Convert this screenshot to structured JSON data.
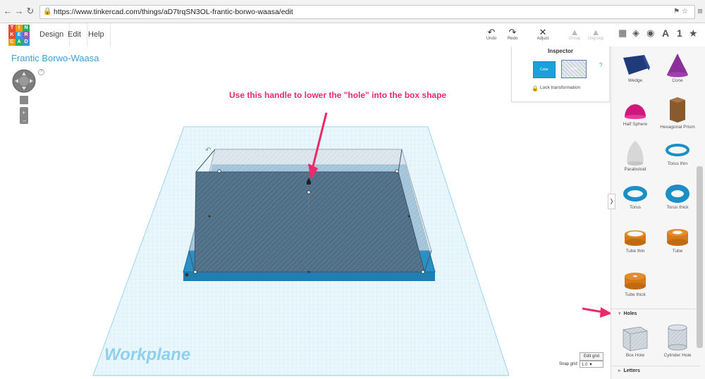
{
  "browser": {
    "url": "https://www.tinkercad.com/things/aD7trqSN3OL-frantic-borwo-waasa/edit",
    "back_icon": "back-arrow-icon",
    "forward_icon": "forward-arrow-icon",
    "reload_icon": "reload-icon"
  },
  "app": {
    "logo_letters": [
      "T",
      "I",
      "N",
      "K",
      "E",
      "R",
      "C",
      "A",
      "D"
    ],
    "logo_colors": [
      "#e94b35",
      "#f39c12",
      "#27ae60",
      "#e94b35",
      "#3498db",
      "#9b59b6",
      "#f39c12",
      "#27ae60",
      "#3498db"
    ],
    "menu": [
      "Design",
      "Edit",
      "Help"
    ],
    "toolbar": [
      {
        "label": "Undo",
        "icon": "↶",
        "disabled": false
      },
      {
        "label": "Redo",
        "icon": "↷",
        "disabled": false
      },
      {
        "label": "Adjust",
        "icon": "✕",
        "disabled": false
      },
      {
        "label": "Group",
        "icon": "▲",
        "disabled": true
      },
      {
        "label": "Ungroup",
        "icon": "▲",
        "disabled": true
      }
    ],
    "panel_tabs": [
      "▦",
      "◈",
      "◉",
      "A",
      "1",
      "★"
    ]
  },
  "canvas": {
    "title": "Frantic Borwo-Waasa",
    "workplane_label": "Workplane",
    "annotation": "Use this handle to lower the \"hole\" into the box shape",
    "edit_grid": "Edit grid",
    "snap_label": "Snap grid",
    "snap_value": "1.0 ▼",
    "help": "?"
  },
  "inspector": {
    "title": "Inspector",
    "color_label": "Color",
    "hole_label": "Hole",
    "help": "?",
    "lock_label": "Lock transformation"
  },
  "shapes": [
    {
      "label": "Wedge",
      "icon": "wedge-icon"
    },
    {
      "label": "Cone",
      "icon": "cone-icon"
    },
    {
      "label": "Half Sphere",
      "icon": "half-sphere-icon"
    },
    {
      "label": "Hexagonal Prism",
      "icon": "hexagonal-prism-icon"
    },
    {
      "label": "Paraboloid",
      "icon": "paraboloid-icon"
    },
    {
      "label": "Torus thin",
      "icon": "torus-thin-icon"
    },
    {
      "label": "Torus",
      "icon": "torus-icon"
    },
    {
      "label": "Torus thick",
      "icon": "torus-thick-icon"
    },
    {
      "label": "Tube thin",
      "icon": "tube-thin-icon"
    },
    {
      "label": "Tube",
      "icon": "tube-icon"
    },
    {
      "label": "Tube thick",
      "icon": "tube-thick-icon"
    }
  ],
  "sections": {
    "holes": "Holes",
    "letters": "Letters"
  },
  "holes": [
    {
      "label": "Box Hole",
      "icon": "box-hole-icon"
    },
    {
      "label": "Cylinder Hole",
      "icon": "cylinder-hole-icon"
    }
  ],
  "colors": {
    "accent": "#3aa0d8",
    "annotation": "#ec2a6a",
    "box": "#1aa0db",
    "grid": "#bfe3f4"
  }
}
